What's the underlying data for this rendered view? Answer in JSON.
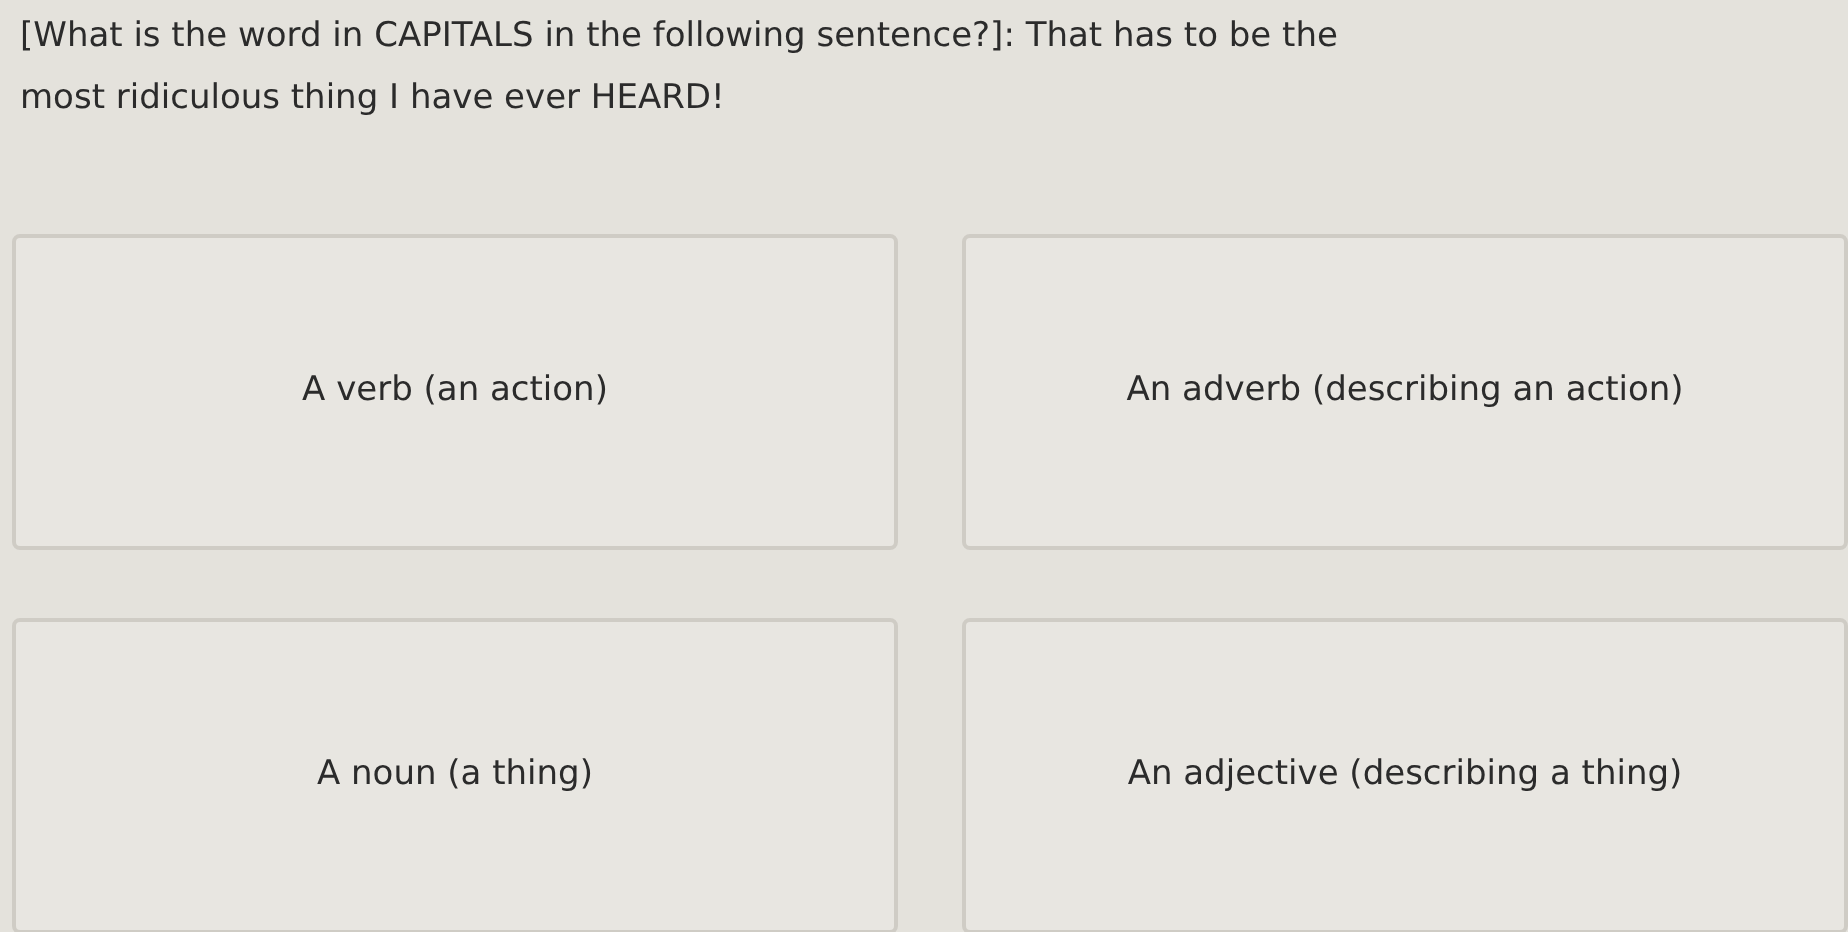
{
  "question": "[What is the word in CAPITALS in the following sentence?]: That has to be the most ridiculous thing I have ever HEARD!",
  "options": [
    {
      "label": "A verb (an action)"
    },
    {
      "label": "An adverb (describing an action)"
    },
    {
      "label": "A noun (a thing)"
    },
    {
      "label": "An adjective (describing a thing)"
    }
  ]
}
